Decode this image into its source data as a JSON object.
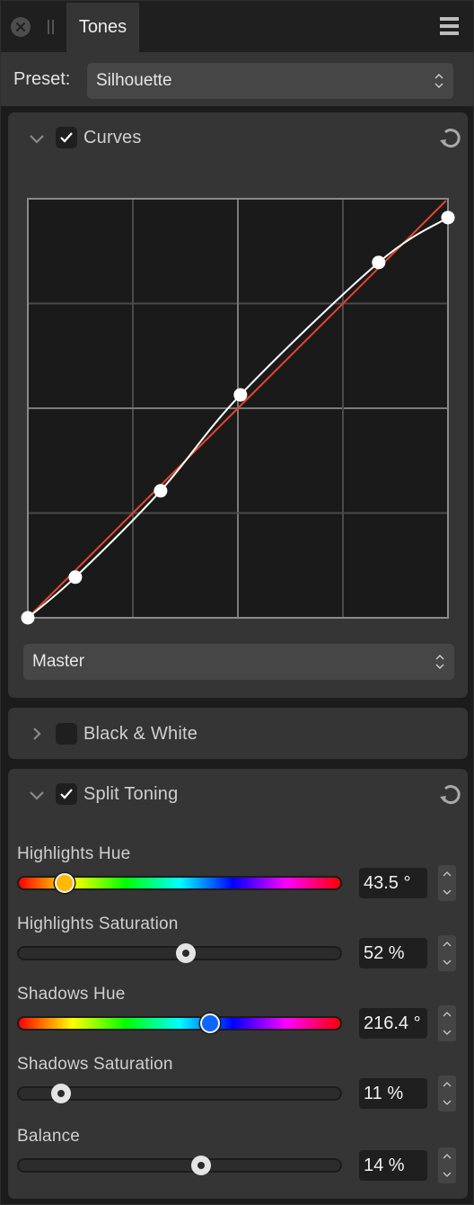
{
  "window": {
    "tab_title": "Tones",
    "icons": {
      "close": "close-icon",
      "grip": "drag-grip-icon",
      "menu": "hamburger-menu-icon"
    }
  },
  "preset": {
    "label": "Preset:",
    "value": "Silhouette"
  },
  "curves": {
    "title": "Curves",
    "enabled": true,
    "expanded": true,
    "channel": "Master",
    "colors": {
      "curve": "#ffffff",
      "baseline": "#e0482a",
      "grid_bg": "#1a1a1a"
    },
    "points": [
      [
        0.0,
        0.0
      ],
      [
        0.113,
        0.097
      ],
      [
        0.316,
        0.303
      ],
      [
        0.506,
        0.532
      ],
      [
        0.835,
        0.848
      ],
      [
        1.0,
        0.955
      ]
    ]
  },
  "black_white": {
    "title": "Black & White",
    "enabled": false,
    "expanded": false
  },
  "split_toning": {
    "title": "Split Toning",
    "enabled": true,
    "expanded": true,
    "sliders": [
      {
        "label": "Highlights Hue",
        "type": "hue",
        "value": 43.5,
        "min": 0,
        "max": 360,
        "display": "43.5 °",
        "thumb_color": "#ffb900"
      },
      {
        "label": "Highlights Saturation",
        "type": "plain",
        "value": 52,
        "min": 0,
        "max": 100,
        "display": "52 %"
      },
      {
        "label": "Shadows Hue",
        "type": "hue",
        "value": 216.4,
        "min": 0,
        "max": 360,
        "display": "216.4 °",
        "thumb_color": "#0a66ff"
      },
      {
        "label": "Shadows Saturation",
        "type": "plain",
        "value": 11,
        "min": 0,
        "max": 100,
        "display": "11 %"
      },
      {
        "label": "Balance",
        "type": "plain",
        "value": 14,
        "min": -100,
        "max": 100,
        "display": "14 %"
      }
    ]
  }
}
